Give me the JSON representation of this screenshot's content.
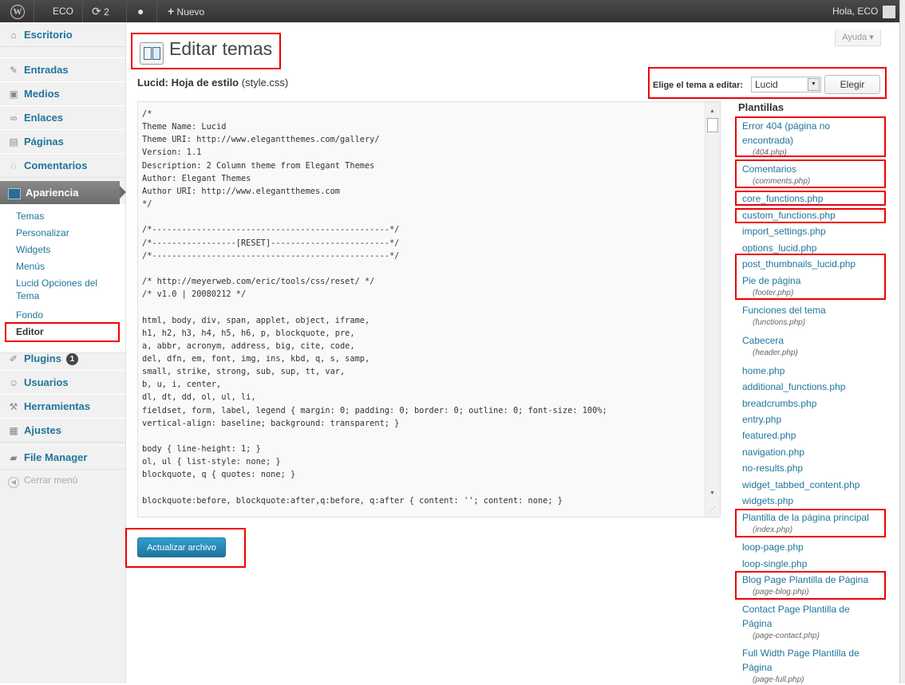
{
  "adminbar": {
    "site_name": "ECO",
    "updates_count": "2",
    "new_label": "Nuevo",
    "greeting": "Hola, ECO"
  },
  "sidebar": {
    "escritorio": "Escritorio",
    "entradas": "Entradas",
    "medios": "Medios",
    "enlaces": "Enlaces",
    "paginas": "Páginas",
    "comentarios": "Comentarios",
    "apariencia": "Apariencia",
    "submenu": [
      "Temas",
      "Personalizar",
      "Widgets",
      "Menús",
      "Lucid Opciones del Tema",
      "Fondo",
      "Editor"
    ],
    "plugins": "Plugins",
    "plugins_badge": "1",
    "usuarios": "Usuarios",
    "herramientas": "Herramientas",
    "ajustes": "Ajustes",
    "file_manager": "File Manager",
    "collapse": "Cerrar menú"
  },
  "header": {
    "title": "Editar temas",
    "help_tab": "Ayuda ▾",
    "file_title": "Lucid: Hoja de estilo",
    "file_name": "(style.css)",
    "theme_label": "Elige el tema a editar:",
    "theme_selected": "Lucid",
    "choose_button": "Elegir"
  },
  "editor": {
    "content": "/*\nTheme Name: Lucid\nTheme URI: http://www.elegantthemes.com/gallery/\nVersion: 1.1\nDescription: 2 Column theme from Elegant Themes\nAuthor: Elegant Themes\nAuthor URI: http://www.elegantthemes.com\n*/\n\n/*------------------------------------------------*/\n/*-----------------[RESET]------------------------*/\n/*------------------------------------------------*/\n\n/* http://meyerweb.com/eric/tools/css/reset/ */\n/* v1.0 | 20080212 */\n\nhtml, body, div, span, applet, object, iframe,\nh1, h2, h3, h4, h5, h6, p, blockquote, pre,\na, abbr, acronym, address, big, cite, code,\ndel, dfn, em, font, img, ins, kbd, q, s, samp,\nsmall, strike, strong, sub, sup, tt, var,\nb, u, i, center,\ndl, dt, dd, ol, ul, li,\nfieldset, form, label, legend { margin: 0; padding: 0; border: 0; outline: 0; font-size: 100%;\nvertical-align: baseline; background: transparent; }\n\nbody { line-height: 1; }\nol, ul { list-style: none; }\nblockquote, q { quotes: none; }\n\nblockquote:before, blockquote:after,q:before, q:after { content: ''; content: none; }",
    "update_button": "Actualizar archivo"
  },
  "templates": {
    "heading": "Plantillas",
    "items": [
      {
        "name": "Error 404 (página no encontrada)",
        "file": "(404.php)"
      },
      {
        "name": "Comentarios",
        "file": "(comments.php)"
      },
      {
        "name": "core_functions.php",
        "file": ""
      },
      {
        "name": "custom_functions.php",
        "file": ""
      },
      {
        "name": "import_settings.php",
        "file": ""
      },
      {
        "name": "options_lucid.php",
        "file": ""
      },
      {
        "name": "post_thumbnails_lucid.php",
        "file": ""
      },
      {
        "name": "Pie de página",
        "file": "(footer.php)"
      },
      {
        "name": "Funciones del tema",
        "file": "(functions.php)"
      },
      {
        "name": "Cabecera",
        "file": "(header.php)"
      },
      {
        "name": "home.php",
        "file": ""
      },
      {
        "name": "additional_functions.php",
        "file": ""
      },
      {
        "name": "breadcrumbs.php",
        "file": ""
      },
      {
        "name": "entry.php",
        "file": ""
      },
      {
        "name": "featured.php",
        "file": ""
      },
      {
        "name": "navigation.php",
        "file": ""
      },
      {
        "name": "no-results.php",
        "file": ""
      },
      {
        "name": "widget_tabbed_content.php",
        "file": ""
      },
      {
        "name": "widgets.php",
        "file": ""
      },
      {
        "name": "Plantilla de la página principal",
        "file": "(index.php)"
      },
      {
        "name": "loop-page.php",
        "file": ""
      },
      {
        "name": "loop-single.php",
        "file": ""
      },
      {
        "name": "Blog Page Plantilla de Página",
        "file": "(page-blog.php)"
      },
      {
        "name": "Contact Page Plantilla de Página",
        "file": "(page-contact.php)"
      },
      {
        "name": "Full Width Page Plantilla de Página",
        "file": "(page-full.php)"
      }
    ]
  },
  "colors": {
    "link": "#21759b",
    "adminbar": "#464646",
    "highlight": "#e00000",
    "primary_button": "#21759b"
  }
}
